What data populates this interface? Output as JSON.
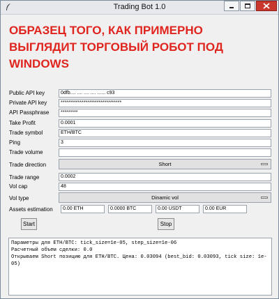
{
  "window": {
    "title": "Trading Bot 1.0",
    "controls": {
      "minimize": "minimize",
      "maximize": "maximize",
      "close": "close"
    }
  },
  "overlay": {
    "lines": [
      "ОБРАЗЕЦ ТОГО, КАК ПРИМЕРНО",
      "ВЫГЛЯДИТ ТОРГОВЫЙ РОБОТ ПОД",
      "WINDOWS"
    ],
    "color": "#e0241e"
  },
  "form": {
    "public_api_key": {
      "label": "Public API key",
      "value": "0dfb.... .... .... .... ...... c93"
    },
    "private_api_key": {
      "label": "Private API key",
      "value": "********************************"
    },
    "api_passphrase": {
      "label": "API Passphrase",
      "value": "*********"
    },
    "take_profit": {
      "label": "Take Profit",
      "value": "0.0001"
    },
    "trade_symbol": {
      "label": "Trade symbol",
      "value": "ETH/BTC"
    },
    "ping": {
      "label": "Ping",
      "value": "3"
    },
    "trade_volume": {
      "label": "Trade volume",
      "value": ""
    },
    "trade_direction": {
      "label": "Trade direction",
      "value": "Short"
    },
    "trade_range": {
      "label": "Trade range",
      "value": "0.0002"
    },
    "vol_cap": {
      "label": "Vol cap",
      "value": "48"
    },
    "vol_type": {
      "label": "Vol type",
      "value": "Dinamic vol"
    },
    "assets_estimation": {
      "label": "Assets estimation",
      "values": [
        "0.00 ETH",
        "0.0000 BTC",
        "0.00 USDT",
        "0.00 EUR"
      ]
    }
  },
  "buttons": {
    "start": "Start",
    "stop": "Stop"
  },
  "log": {
    "lines": [
      "Параметры для ETH/BTC: tick_size=1e-05, step_size=1e-06",
      "Расчетный объем сделки: 0.0",
      "Открываем Short позицию для ETH/BTC. Цена: 0.03094 (best_bid: 0.03093, tick size: 1e-05)"
    ]
  }
}
